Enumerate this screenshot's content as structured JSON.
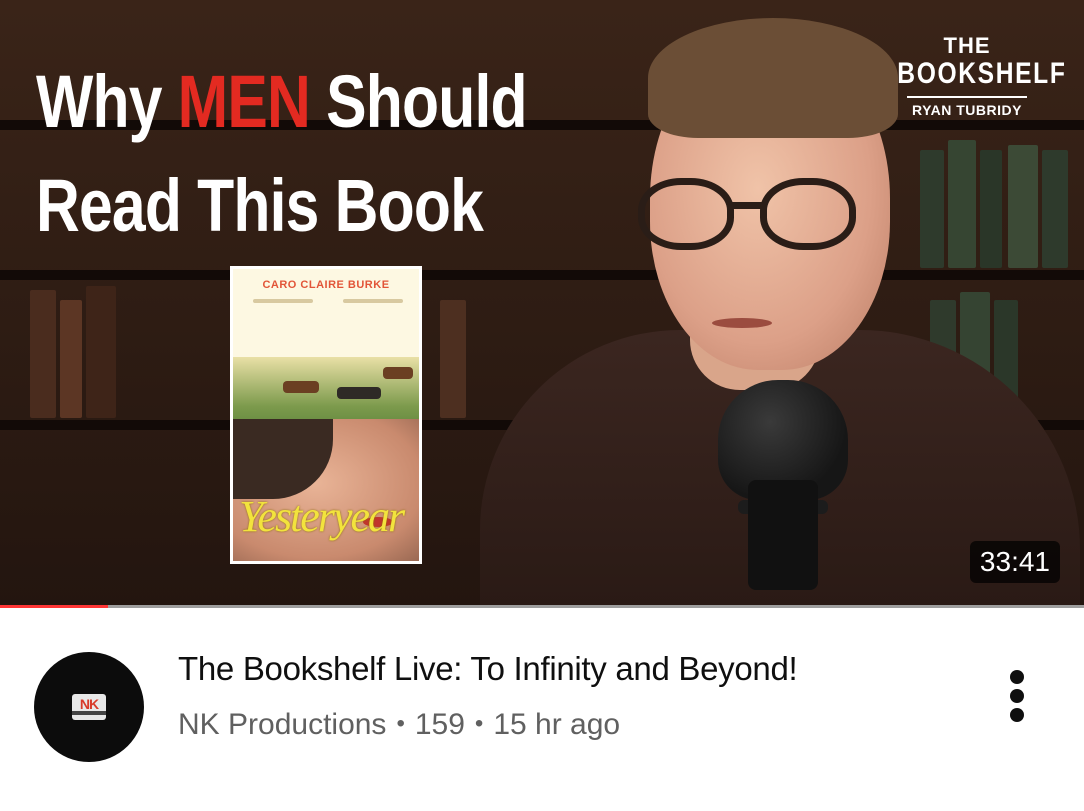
{
  "thumbnail": {
    "headline": {
      "line1_pre": "Why ",
      "line1_accent": "MEN",
      "line1_post": " Should",
      "line2": "Read This Book"
    },
    "brand": {
      "the": "THE",
      "name": "BOOKSHELF",
      "host": "RYAN TUBRIDY"
    },
    "book": {
      "author": "CARO CLAIRE BURKE",
      "title": "Yesteryear"
    },
    "duration": "33:41",
    "watch_progress": 0.1,
    "colors": {
      "accent": "#e32a21",
      "progress": "#ff3535"
    }
  },
  "video": {
    "title": "The Bookshelf Live: To Infinity and Beyond!",
    "channel": "NK Productions",
    "views": "159",
    "age": "15 hr ago",
    "separator": "•"
  },
  "channel_avatar": {
    "logo_text": "NK"
  },
  "icons": {
    "more": "more-vert-icon"
  }
}
